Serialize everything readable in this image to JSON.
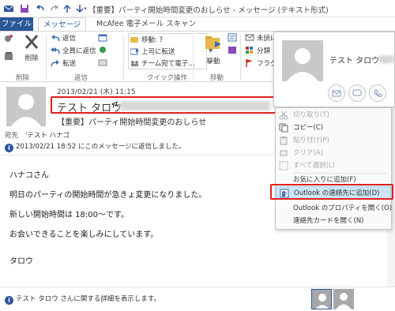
{
  "window": {
    "title": "【重要】パーティ開始時間変更のおしらせ - メッセージ (テキスト形式)"
  },
  "quick_access": {
    "icons": [
      "mail-icon",
      "save-icon",
      "undo-icon",
      "redo-icon",
      "up-arrow-icon",
      "down-arrow-icon",
      "customize-icon"
    ]
  },
  "tabs": [
    {
      "label": "ファイル",
      "active": false
    },
    {
      "label": "メッセージ",
      "active": true
    },
    {
      "label": "McAfee 電子メール スキャン",
      "active": false
    }
  ],
  "ribbon": {
    "delete": {
      "label": "削除",
      "group": "削除"
    },
    "respond": {
      "group": "返信",
      "reply": "返信",
      "reply_all": "全員に返信",
      "forward": "転送"
    },
    "quick_steps": {
      "group": "クイック操作",
      "items": [
        "移動: ?",
        "上司に転送",
        "チーム宛て電子…"
      ]
    },
    "move": {
      "label": "移動",
      "group": "移動"
    },
    "tags": {
      "group": "タグ",
      "unread": "未読にする",
      "categorize": "分類",
      "flag": "フラグの"
    }
  },
  "message": {
    "datetime": "2013/02/21 (木) 11:15",
    "sender_name": "テスト タロウ",
    "subject": "【重要】パーティ開始時間変更のおしらせ",
    "to_label": "宛先",
    "to_value": "'テスト ハナゴ",
    "info": "2013/02/21 18:52 にこのメッセージに返信しました。",
    "body": [
      "ハナコさん",
      "明日のパーティの開始時間が急きょ変更になりました。",
      "新しい開始時間は 18:00〜です。",
      "お会いできることを楽しみにしています。",
      "タロウ"
    ]
  },
  "contact_card": {
    "name": "テスト タロウ <",
    "actions": [
      "mail-icon",
      "chat-icon",
      "phone-icon",
      "video-icon"
    ]
  },
  "context_menu": {
    "items": [
      {
        "label": "切り取り(T)",
        "icon": "cut-icon",
        "disabled": true
      },
      {
        "label": "コピー(C)",
        "icon": "copy-icon",
        "disabled": false
      },
      {
        "label": "貼り付け(P)",
        "icon": "paste-icon",
        "disabled": true
      },
      {
        "label": "クリア(A)",
        "icon": "clear-icon",
        "disabled": true
      },
      {
        "label": "すべて選択(L)",
        "icon": "select-all-icon",
        "disabled": true
      },
      {
        "label": "お気に入りに追加(F)",
        "icon": "",
        "disabled": false
      },
      {
        "label": "Outlook の連絡先に追加(D)",
        "icon": "add-contact-icon",
        "disabled": false,
        "highlighted": true
      },
      {
        "label": "Outlook のプロパティを開く(O)",
        "icon": "",
        "disabled": false
      },
      {
        "label": "連絡先カードを開く(N)",
        "icon": "",
        "disabled": false
      }
    ]
  },
  "footer": {
    "info": "テスト タロウ さんに関する詳細を表示します。"
  },
  "colors": {
    "accent": "#2b579a",
    "highlight_red": "#e0201b",
    "menu_highlight": "#cde6f7"
  }
}
